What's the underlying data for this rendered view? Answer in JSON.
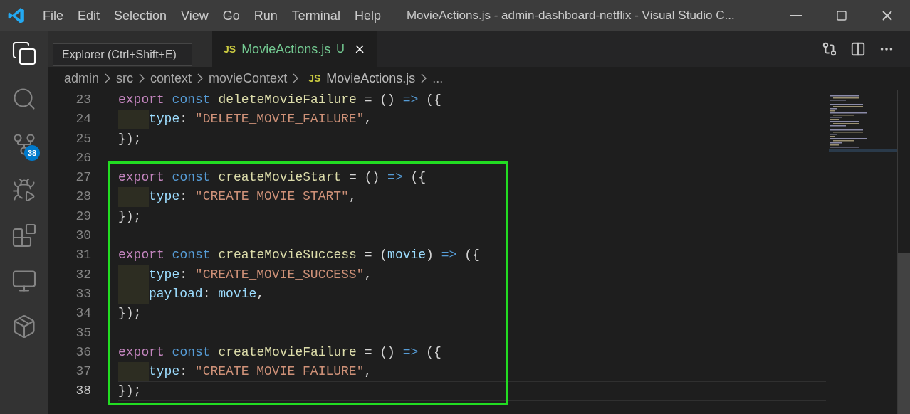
{
  "window": {
    "title": "MovieActions.js - admin-dashboard-netflix - Visual Studio C...",
    "menu": [
      "File",
      "Edit",
      "Selection",
      "View",
      "Go",
      "Run",
      "Terminal",
      "Help"
    ]
  },
  "activity_bar": [
    {
      "kind": "explorer",
      "selected": true
    },
    {
      "kind": "search",
      "selected": false
    },
    {
      "kind": "source-control",
      "selected": false,
      "badge": "38"
    },
    {
      "kind": "run-debug",
      "selected": false
    },
    {
      "kind": "extensions",
      "selected": false
    },
    {
      "kind": "remote",
      "selected": false
    },
    {
      "kind": "package",
      "selected": false
    }
  ],
  "tooltip": "Explorer (Ctrl+Shift+E)",
  "tabs": [
    {
      "selected": false
    },
    {
      "icon": "JS",
      "label": "MovieActions.js",
      "status": "U",
      "selected": true
    }
  ],
  "breadcrumbs": [
    {
      "kind": "folder",
      "label": "admin"
    },
    {
      "kind": "folder",
      "label": "src"
    },
    {
      "kind": "folder",
      "label": "context"
    },
    {
      "kind": "folder",
      "label": "movieContext"
    },
    {
      "kind": "file",
      "icon": "JS",
      "label": "MovieActions.js"
    },
    {
      "kind": "more",
      "label": "..."
    }
  ],
  "editor": {
    "lines": [
      {
        "number": "23",
        "indent": false,
        "boxed": false,
        "current": false,
        "tokens": [
          {
            "kind": "keyword",
            "text": "export"
          },
          {
            "kind": "storage",
            "text": " const "
          },
          {
            "kind": "function",
            "text": "deleteMovieFailure"
          },
          {
            "kind": "plain",
            "text": " = () "
          },
          {
            "kind": "storage",
            "text": "=>"
          },
          {
            "kind": "plain",
            "text": " ({"
          }
        ]
      },
      {
        "number": "24",
        "indent": true,
        "boxed": false,
        "current": false,
        "tokens": [
          {
            "kind": "property",
            "text": "type"
          },
          {
            "kind": "plain",
            "text": ": "
          },
          {
            "kind": "string",
            "text": "\"DELETE_MOVIE_FAILURE\""
          },
          {
            "kind": "plain",
            "text": ","
          }
        ]
      },
      {
        "number": "25",
        "indent": false,
        "boxed": false,
        "current": false,
        "tokens": [
          {
            "kind": "plain",
            "text": "});"
          }
        ]
      },
      {
        "number": "26",
        "indent": false,
        "boxed": false,
        "current": false
      },
      {
        "number": "27",
        "indent": false,
        "boxed": true,
        "current": false,
        "tokens": [
          {
            "kind": "keyword",
            "text": "export"
          },
          {
            "kind": "storage",
            "text": " const "
          },
          {
            "kind": "function",
            "text": "createMovieStart"
          },
          {
            "kind": "plain",
            "text": " = () "
          },
          {
            "kind": "storage",
            "text": "=>"
          },
          {
            "kind": "plain",
            "text": " ({"
          }
        ]
      },
      {
        "number": "28",
        "indent": true,
        "boxed": true,
        "current": false,
        "tokens": [
          {
            "kind": "property",
            "text": "type"
          },
          {
            "kind": "plain",
            "text": ": "
          },
          {
            "kind": "string",
            "text": "\"CREATE_MOVIE_START\""
          },
          {
            "kind": "plain",
            "text": ","
          }
        ]
      },
      {
        "number": "29",
        "indent": false,
        "boxed": true,
        "current": false,
        "tokens": [
          {
            "kind": "plain",
            "text": "});"
          }
        ]
      },
      {
        "number": "30",
        "indent": false,
        "boxed": true,
        "current": false
      },
      {
        "number": "31",
        "indent": false,
        "boxed": true,
        "current": false,
        "tokens": [
          {
            "kind": "keyword",
            "text": "export"
          },
          {
            "kind": "storage",
            "text": " const "
          },
          {
            "kind": "function",
            "text": "createMovieSuccess"
          },
          {
            "kind": "plain",
            "text": " = ("
          },
          {
            "kind": "param",
            "text": "movie"
          },
          {
            "kind": "plain",
            "text": ") "
          },
          {
            "kind": "storage",
            "text": "=>"
          },
          {
            "kind": "plain",
            "text": " ({"
          }
        ]
      },
      {
        "number": "32",
        "indent": true,
        "boxed": true,
        "current": false,
        "tokens": [
          {
            "kind": "property",
            "text": "type"
          },
          {
            "kind": "plain",
            "text": ": "
          },
          {
            "kind": "string",
            "text": "\"CREATE_MOVIE_SUCCESS\""
          },
          {
            "kind": "plain",
            "text": ","
          }
        ]
      },
      {
        "number": "33",
        "indent": true,
        "boxed": true,
        "current": false,
        "tokens": [
          {
            "kind": "property",
            "text": "payload"
          },
          {
            "kind": "plain",
            "text": ": "
          },
          {
            "kind": "param",
            "text": "movie"
          },
          {
            "kind": "plain",
            "text": ","
          }
        ]
      },
      {
        "number": "34",
        "indent": false,
        "boxed": true,
        "current": false,
        "tokens": [
          {
            "kind": "plain",
            "text": "});"
          }
        ]
      },
      {
        "number": "35",
        "indent": false,
        "boxed": true,
        "current": false
      },
      {
        "number": "36",
        "indent": false,
        "boxed": true,
        "current": false,
        "tokens": [
          {
            "kind": "keyword",
            "text": "export"
          },
          {
            "kind": "storage",
            "text": " const "
          },
          {
            "kind": "function",
            "text": "createMovieFailure"
          },
          {
            "kind": "plain",
            "text": " = () "
          },
          {
            "kind": "storage",
            "text": "=>"
          },
          {
            "kind": "plain",
            "text": " ({"
          }
        ]
      },
      {
        "number": "37",
        "indent": true,
        "boxed": true,
        "current": false,
        "tokens": [
          {
            "kind": "property",
            "text": "type"
          },
          {
            "kind": "plain",
            "text": ": "
          },
          {
            "kind": "string",
            "text": "\"CREATE_MOVIE_FAILURE\""
          },
          {
            "kind": "plain",
            "text": ","
          }
        ]
      },
      {
        "number": "38",
        "indent": false,
        "boxed": true,
        "current": true,
        "tokens": [
          {
            "kind": "plain",
            "text": "});"
          }
        ]
      }
    ]
  }
}
